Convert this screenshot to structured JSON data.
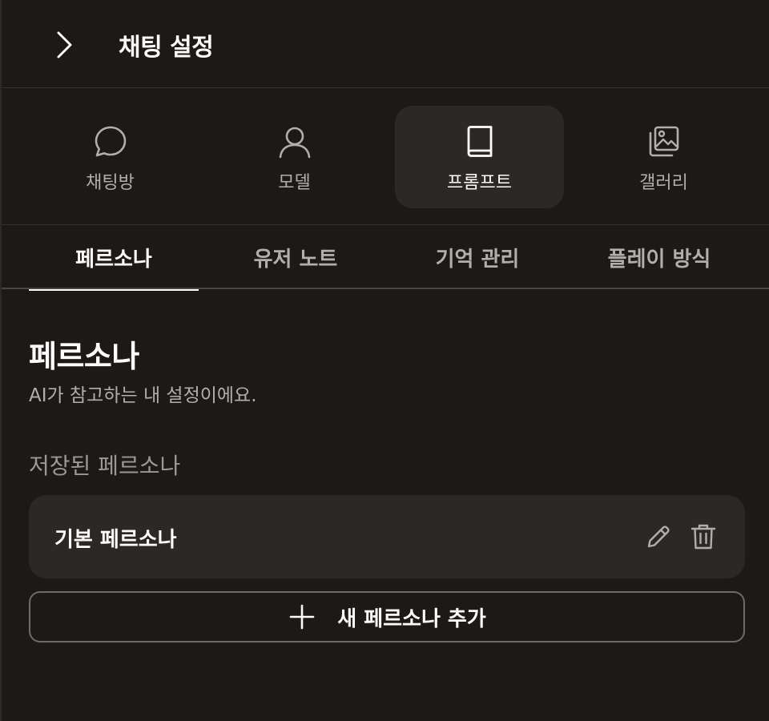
{
  "header": {
    "title": "채팅 설정",
    "back_icon": "chevron-right-icon"
  },
  "categories": [
    {
      "label": "채팅방",
      "icon": "chat-bubble-icon",
      "active": false
    },
    {
      "label": "모델",
      "icon": "user-icon",
      "active": false
    },
    {
      "label": "프롬프트",
      "icon": "book-icon",
      "active": true
    },
    {
      "label": "갤러리",
      "icon": "gallery-icon",
      "active": false
    }
  ],
  "subtabs": [
    {
      "label": "페르소나",
      "active": true
    },
    {
      "label": "유저 노트",
      "active": false
    },
    {
      "label": "기억 관리",
      "active": false
    },
    {
      "label": "플레이 방식",
      "active": false
    }
  ],
  "section": {
    "title": "페르소나",
    "description": "AI가 참고하는 내 설정이에요.",
    "saved_label": "저장된 페르소나"
  },
  "personas": [
    {
      "name": "기본 페르소나",
      "edit_icon": "pencil-icon",
      "delete_icon": "trash-icon"
    }
  ],
  "add_button": {
    "label": "새 페르소나 추가",
    "icon": "plus-icon"
  },
  "colors": {
    "background": "#1c1916",
    "card": "#2b2826",
    "text_primary": "#ffffff",
    "text_secondary": "#b3aea9"
  }
}
